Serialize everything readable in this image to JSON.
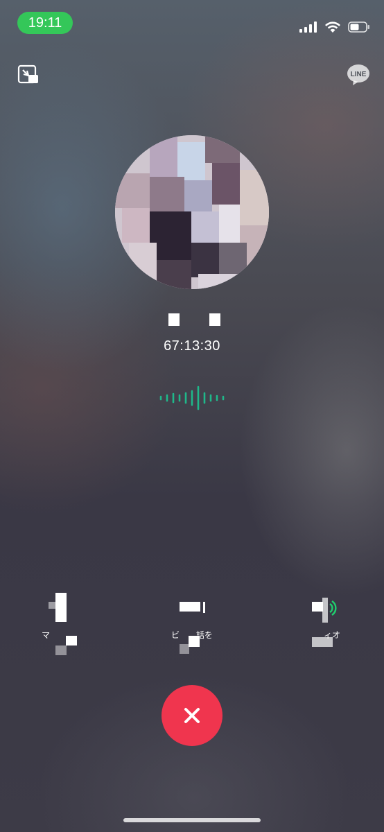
{
  "status_bar": {
    "time": "19:11",
    "icons": [
      "cellular-signal-icon",
      "wifi-icon",
      "battery-icon"
    ]
  },
  "header": {
    "minimize_icon": "minimize-window-icon",
    "brand_logo_text": "LINE"
  },
  "call": {
    "caller_name": "",
    "duration": "67:13:30",
    "voice_indicator_color": "#1fb88a"
  },
  "controls": [
    {
      "id": "mute",
      "label": "マ",
      "icon": "microphone-icon"
    },
    {
      "id": "video",
      "label": "ビ　　話を",
      "icon": "video-camera-icon"
    },
    {
      "id": "speaker",
      "label": "ィオ",
      "icon": "speaker-icon"
    }
  ],
  "end_call": {
    "icon": "close-icon",
    "color": "#f0354e"
  },
  "colors": {
    "status_pill": "#34c759",
    "accent_green": "#1fb88a",
    "end_call_red": "#f0354e"
  }
}
